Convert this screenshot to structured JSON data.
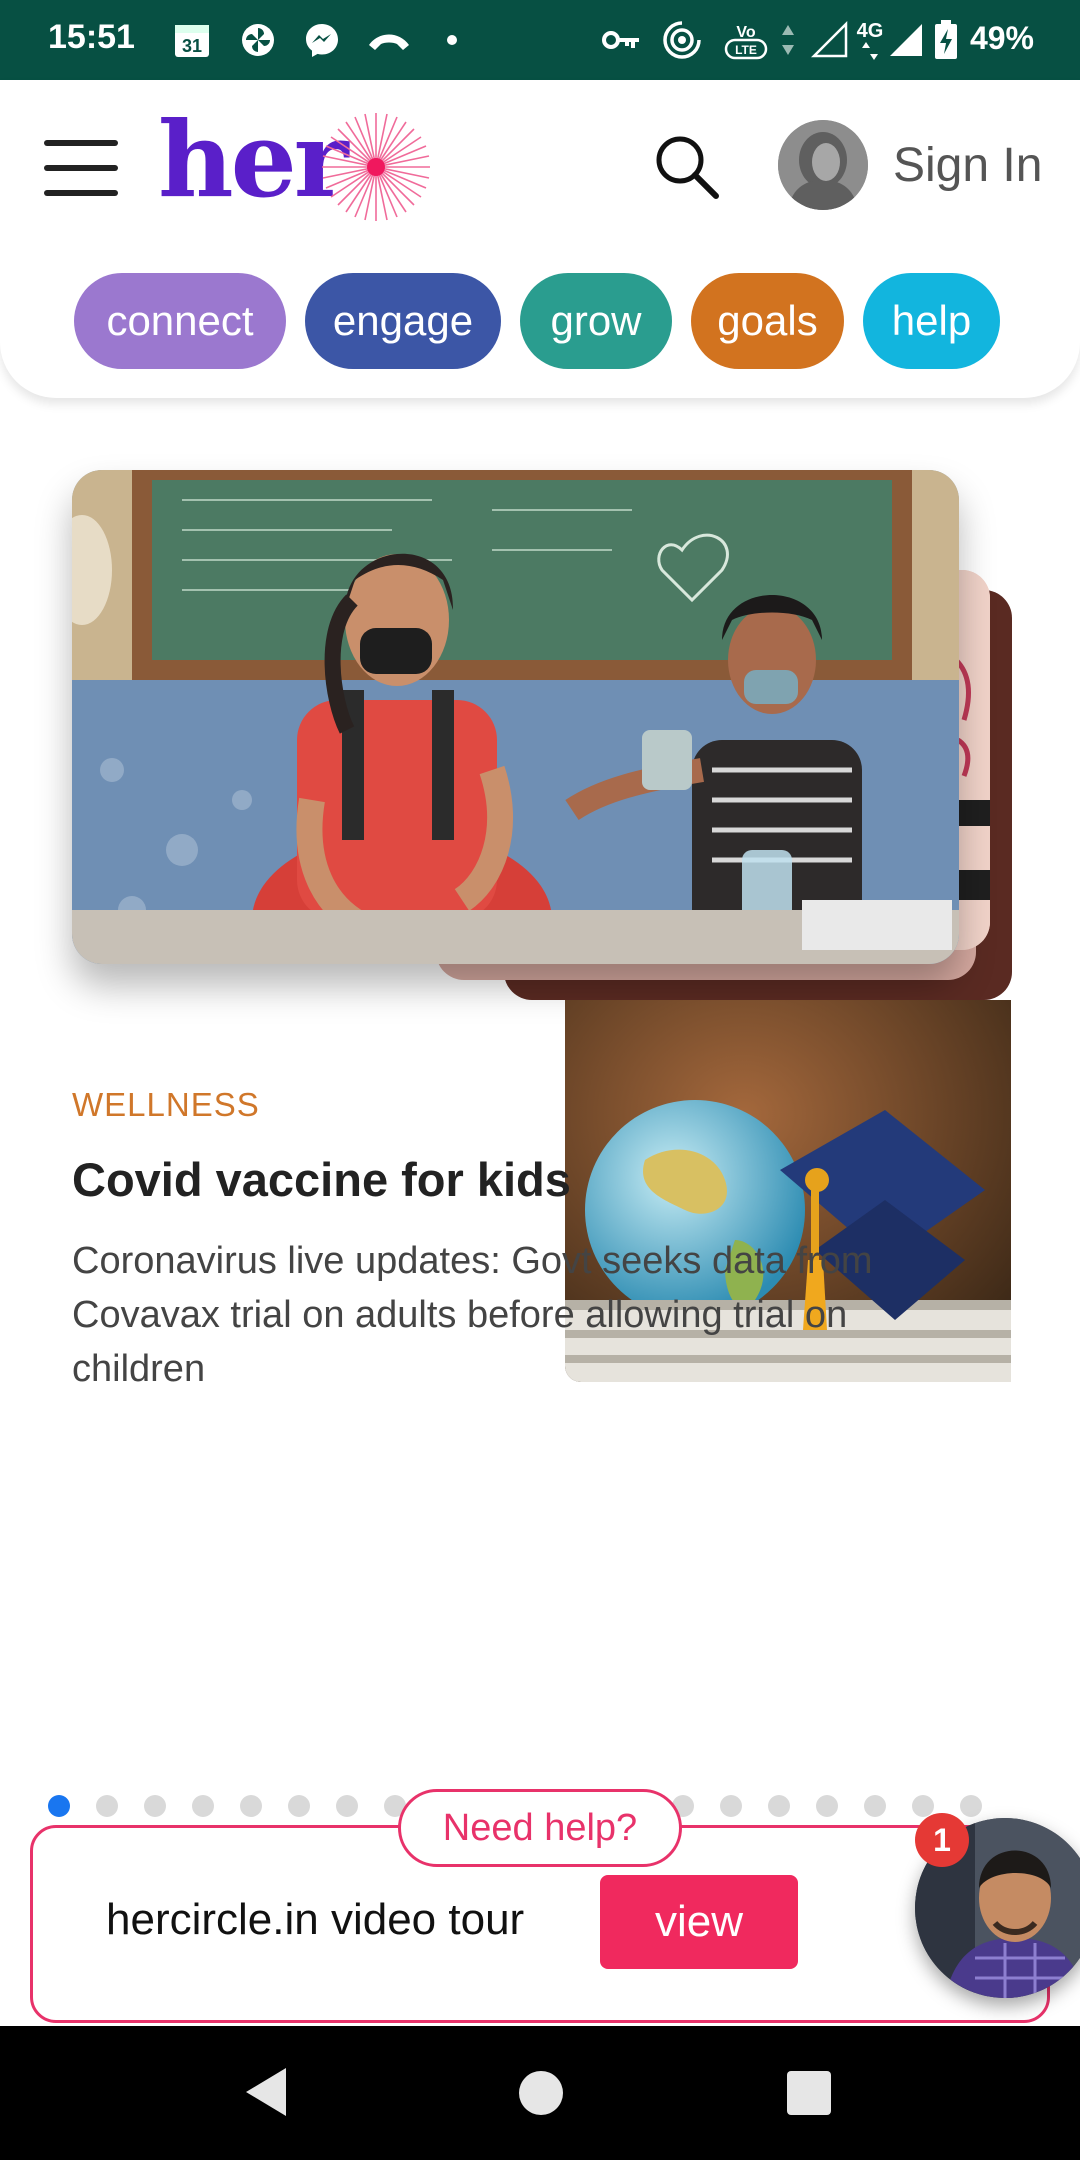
{
  "status_bar": {
    "time": "15:51",
    "calendar_day": "31",
    "battery": "49%",
    "network": "4G",
    "volte": "Vo LTE",
    "background": "#075043"
  },
  "header": {
    "logo_text": "her",
    "sign_in_label": "Sign In",
    "nav_pills": [
      {
        "label": "connect",
        "color": "#9b78cf"
      },
      {
        "label": "engage",
        "color": "#3c56a6"
      },
      {
        "label": "grow",
        "color": "#2a9d8f"
      },
      {
        "label": "goals",
        "color": "#d2731f"
      },
      {
        "label": "help",
        "color": "#12b5de"
      }
    ]
  },
  "article": {
    "category": "WELLNESS",
    "title": "Covid vaccine for kids",
    "excerpt": "Coronavirus live updates: Govt seeks data from Covavax trial on adults before allowing trial on children"
  },
  "carousel": {
    "total_slides": 20,
    "active_index": 0
  },
  "help_banner": {
    "badge_label": "Need help?",
    "tour_text": "hercircle.in video tour",
    "view_label": "view",
    "notification_count": "1",
    "accent": "#e8326a"
  }
}
